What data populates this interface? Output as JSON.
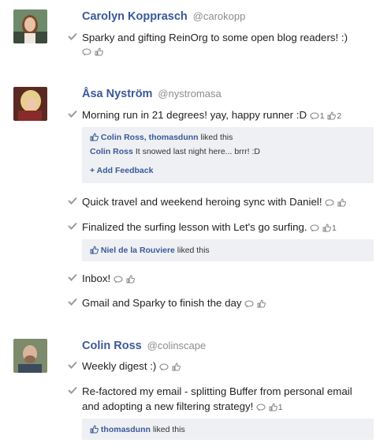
{
  "users": [
    {
      "name": "Carolyn Kopprasch",
      "handle": "@carokopp",
      "items": [
        {
          "text": "Sparky and gifting ReinOrg to some open blog readers! :)"
        }
      ]
    },
    {
      "name": "Åsa Nyström",
      "handle": "@nystromasa",
      "items": [
        {
          "text": "Morning run in 21 degrees! yay, happy runner :D",
          "comment_count": "1",
          "like_count": "2",
          "liked_by": "Colin Ross, thomasdunn",
          "liked_suffix": "liked this",
          "comment": {
            "author": "Colin Ross",
            "text": "It snowed last night here... brrr! :D"
          },
          "add_feedback": "+ Add Feedback"
        },
        {
          "text": "Quick travel and weekend heroing sync with Daniel!"
        },
        {
          "text": "Finalized the surfing lesson with Let's go surfing.",
          "like_count": "1",
          "liked_by": "Niel de la Rouviere",
          "liked_suffix": "liked this"
        },
        {
          "text": "Inbox!"
        },
        {
          "text": "Gmail and Sparky to finish the day"
        }
      ]
    },
    {
      "name": "Colin Ross",
      "handle": "@colinscape",
      "items": [
        {
          "text": "Weekly digest :)"
        },
        {
          "text_line1": "Re-factored my email - splitting Buffer from personal email",
          "text_line2": "and adopting a new filtering strategy!",
          "like_count": "1",
          "liked_by": "thomasdunn",
          "liked_suffix": "liked this"
        }
      ]
    }
  ]
}
